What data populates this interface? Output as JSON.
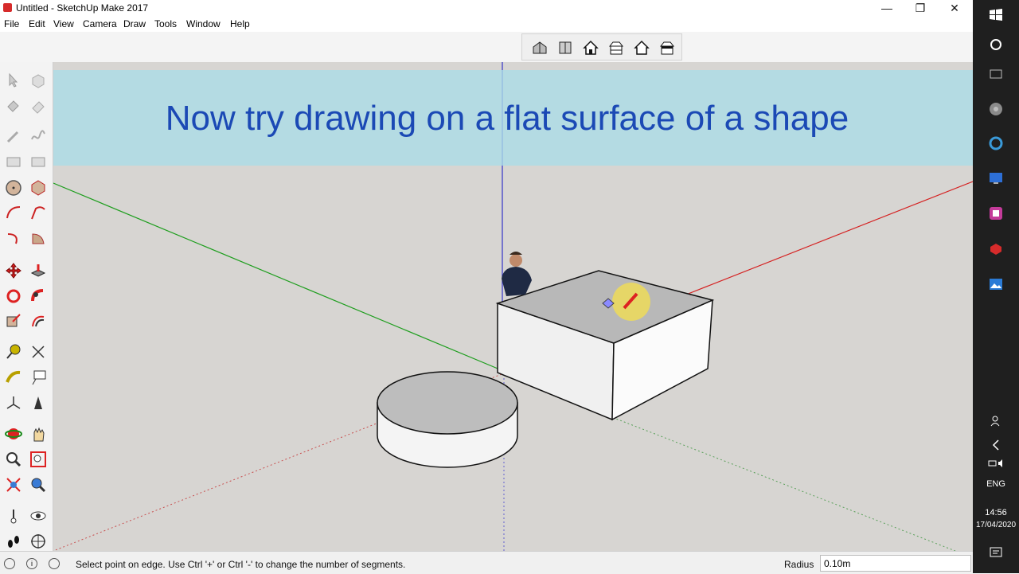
{
  "window": {
    "title": "Untitled - SketchUp Make 2017",
    "minimize": "—",
    "restore": "❐",
    "close": "✕"
  },
  "menu": [
    "File",
    "Edit",
    "View",
    "Camera",
    "Draw",
    "Tools",
    "Window",
    "Help"
  ],
  "top_toolbar": {
    "icons": [
      "iso-view-icon",
      "top-view-icon",
      "front-view-icon",
      "right-view-icon",
      "back-view-icon",
      "left-view-icon"
    ]
  },
  "banner": {
    "text": "Now try drawing on a flat surface of a shape"
  },
  "status": {
    "text": "Select point on edge. Use Ctrl '+' or Ctrl '-' to change the number of segments.",
    "measure_label": "Radius",
    "measure_value": "0.10m"
  },
  "taskbar": {
    "lang": "ENG",
    "time": "14:56",
    "date": "17/04/2020"
  },
  "colors": {
    "red_axis": "#d52020",
    "green_axis": "#1e9e1e",
    "blue_axis": "#3434c8",
    "banner_text": "#1b49b5"
  }
}
